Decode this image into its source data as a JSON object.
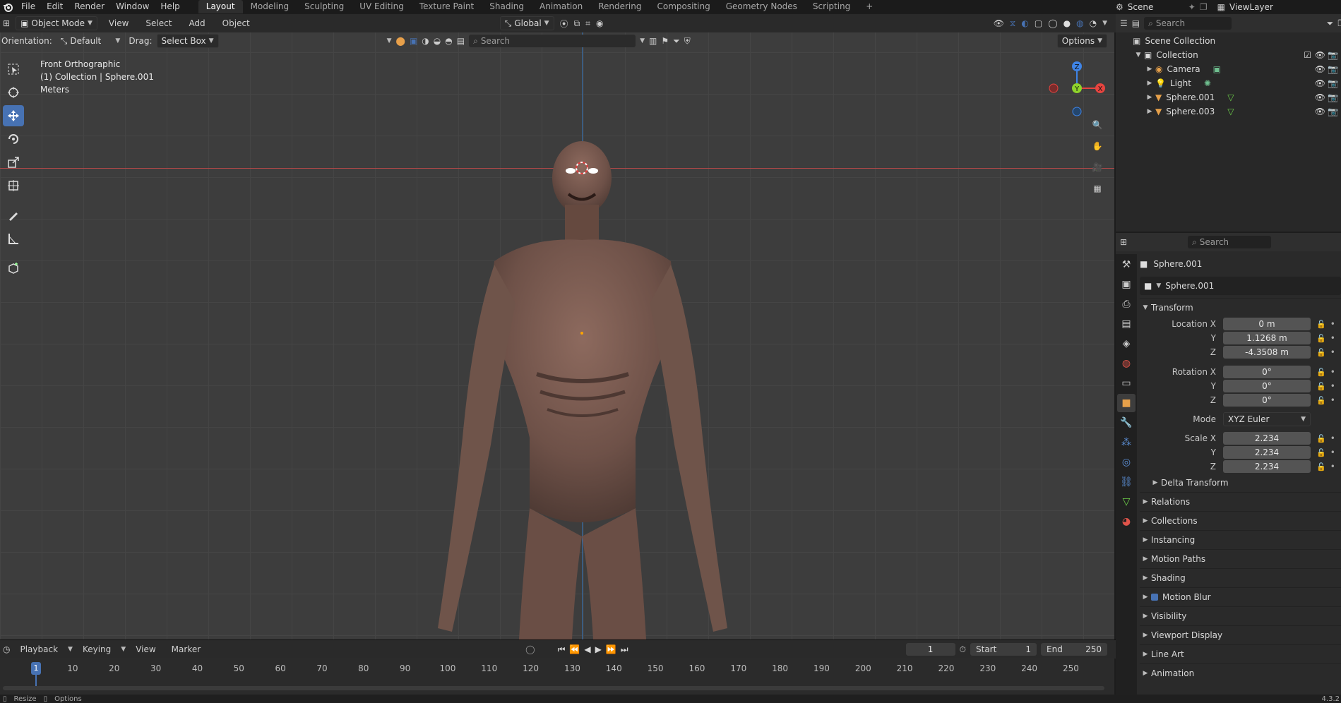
{
  "topbar": {
    "menus": [
      "File",
      "Edit",
      "Render",
      "Window",
      "Help"
    ],
    "workspaces": [
      "Layout",
      "Modeling",
      "Sculpting",
      "UV Editing",
      "Texture Paint",
      "Shading",
      "Animation",
      "Rendering",
      "Compositing",
      "Geometry Nodes",
      "Scripting"
    ],
    "active_workspace": "Layout",
    "scene": "Scene",
    "view_layer": "ViewLayer"
  },
  "viewport_header": {
    "mode": "Object Mode",
    "menus": [
      "View",
      "Select",
      "Add",
      "Object"
    ],
    "transform_orientation": "Global",
    "orientation_label": "Orientation:",
    "orientation_value": "Default",
    "drag_label": "Drag:",
    "drag_value": "Select Box",
    "search_placeholder": "Search",
    "options_label": "Options"
  },
  "viewport_overlay": {
    "view_name": "Front Orthographic",
    "collection_info": "(1) Collection | Sphere.001",
    "units": "Meters"
  },
  "gizmo": {
    "z": "Z",
    "y": "Y",
    "x": "X"
  },
  "outliner": {
    "search_placeholder": "Search",
    "root": "Scene Collection",
    "collection": "Collection",
    "items": [
      {
        "name": "Camera"
      },
      {
        "name": "Light"
      },
      {
        "name": "Sphere.001"
      },
      {
        "name": "Sphere.003"
      }
    ]
  },
  "properties": {
    "search_placeholder": "Search",
    "object_name": "Sphere.001",
    "object_field": "Sphere.001",
    "transform_title": "Transform",
    "location": {
      "label": "Location X",
      "x": "0 m",
      "y": "1.1268 m",
      "z": "-4.3508 m"
    },
    "rotation": {
      "label": "Rotation X",
      "x": "0°",
      "y": "0°",
      "z": "0°"
    },
    "mode_label": "Mode",
    "mode_value": "XYZ Euler",
    "scale": {
      "label": "Scale X",
      "x": "2.234",
      "y": "2.234",
      "z": "2.234"
    },
    "axis_y": "Y",
    "axis_z": "Z",
    "delta_transform": "Delta Transform",
    "panels": [
      "Relations",
      "Collections",
      "Instancing",
      "Motion Paths",
      "Shading",
      "Motion Blur",
      "Visibility",
      "Viewport Display",
      "Line Art",
      "Animation"
    ]
  },
  "timeline": {
    "menus": [
      "Playback",
      "Keying",
      "View",
      "Marker"
    ],
    "current_frame": "1",
    "start_label": "Start",
    "start": "1",
    "end_label": "End",
    "end": "250",
    "ruler_labels": [
      "1",
      "10",
      "20",
      "30",
      "40",
      "50",
      "60",
      "70",
      "80",
      "90",
      "100",
      "110",
      "120",
      "130",
      "140",
      "150",
      "160",
      "170",
      "180",
      "190",
      "200",
      "210",
      "220",
      "230",
      "240",
      "250"
    ]
  },
  "statusbar": {
    "left1": "Resize",
    "left2": "Options",
    "version": "4.3.2"
  },
  "colors": {
    "accent": "#4772b3",
    "x_axis": "#e6443f",
    "y_axis": "#8fd32b",
    "z_axis": "#3f84e6"
  }
}
